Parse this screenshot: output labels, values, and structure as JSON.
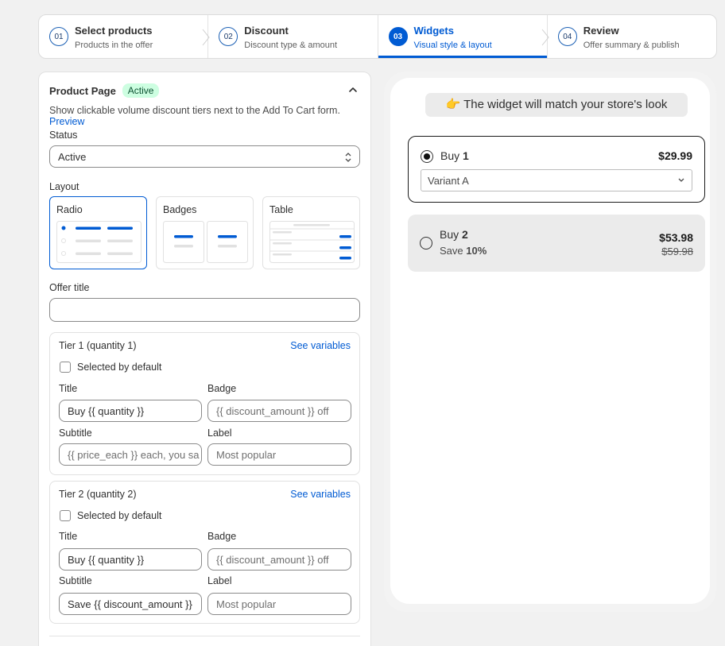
{
  "steps": [
    {
      "num": "01",
      "title": "Select products",
      "sub": "Products in the offer"
    },
    {
      "num": "02",
      "title": "Discount",
      "sub": "Discount type & amount"
    },
    {
      "num": "03",
      "title": "Widgets",
      "sub": "Visual style & layout"
    },
    {
      "num": "04",
      "title": "Review",
      "sub": "Offer summary & publish"
    }
  ],
  "card": {
    "title": "Product Page",
    "badge": "Active",
    "description": "Show clickable volume discount tiers next to the Add To Cart form.",
    "preview_link": "Preview",
    "status_label": "Status",
    "status_value": "Active",
    "layout_label": "Layout",
    "layouts": [
      {
        "name": "Radio"
      },
      {
        "name": "Badges"
      },
      {
        "name": "Table"
      }
    ],
    "offer_title_label": "Offer title",
    "offer_title_value": ""
  },
  "tiers": [
    {
      "heading": "Tier 1 (quantity 1)",
      "see_vars": "See variables",
      "selected_label": "Selected by default",
      "title_label": "Title",
      "title_value": "Buy {{ quantity }}",
      "badge_label": "Badge",
      "badge_placeholder": "{{ discount_amount }} off",
      "subtitle_label": "Subtitle",
      "subtitle_placeholder": "{{ price_each }} each, you sa",
      "label_label": "Label",
      "label_placeholder": "Most popular"
    },
    {
      "heading": "Tier 2 (quantity 2)",
      "see_vars": "See variables",
      "selected_label": "Selected by default",
      "title_label": "Title",
      "title_value": "Buy {{ quantity }}",
      "badge_label": "Badge",
      "badge_placeholder": "{{ discount_amount }} off",
      "subtitle_label": "Subtitle",
      "subtitle_value": "Save {{ discount_amount }}",
      "label_label": "Label",
      "label_placeholder": "Most popular"
    }
  ],
  "preview": {
    "notice": "👉 The widget will match your store's look",
    "option1": {
      "buy": "Buy",
      "qty": "1",
      "price": "$29.99",
      "variant": "Variant A"
    },
    "option2": {
      "buy": "Buy",
      "qty": "2",
      "save": "Save",
      "save_pct": "10%",
      "price": "$53.98",
      "compare": "$59.98"
    }
  },
  "colors": {
    "accent": "#005bd3",
    "badge_bg": "#cdfee1",
    "badge_text": "#0c5132"
  }
}
